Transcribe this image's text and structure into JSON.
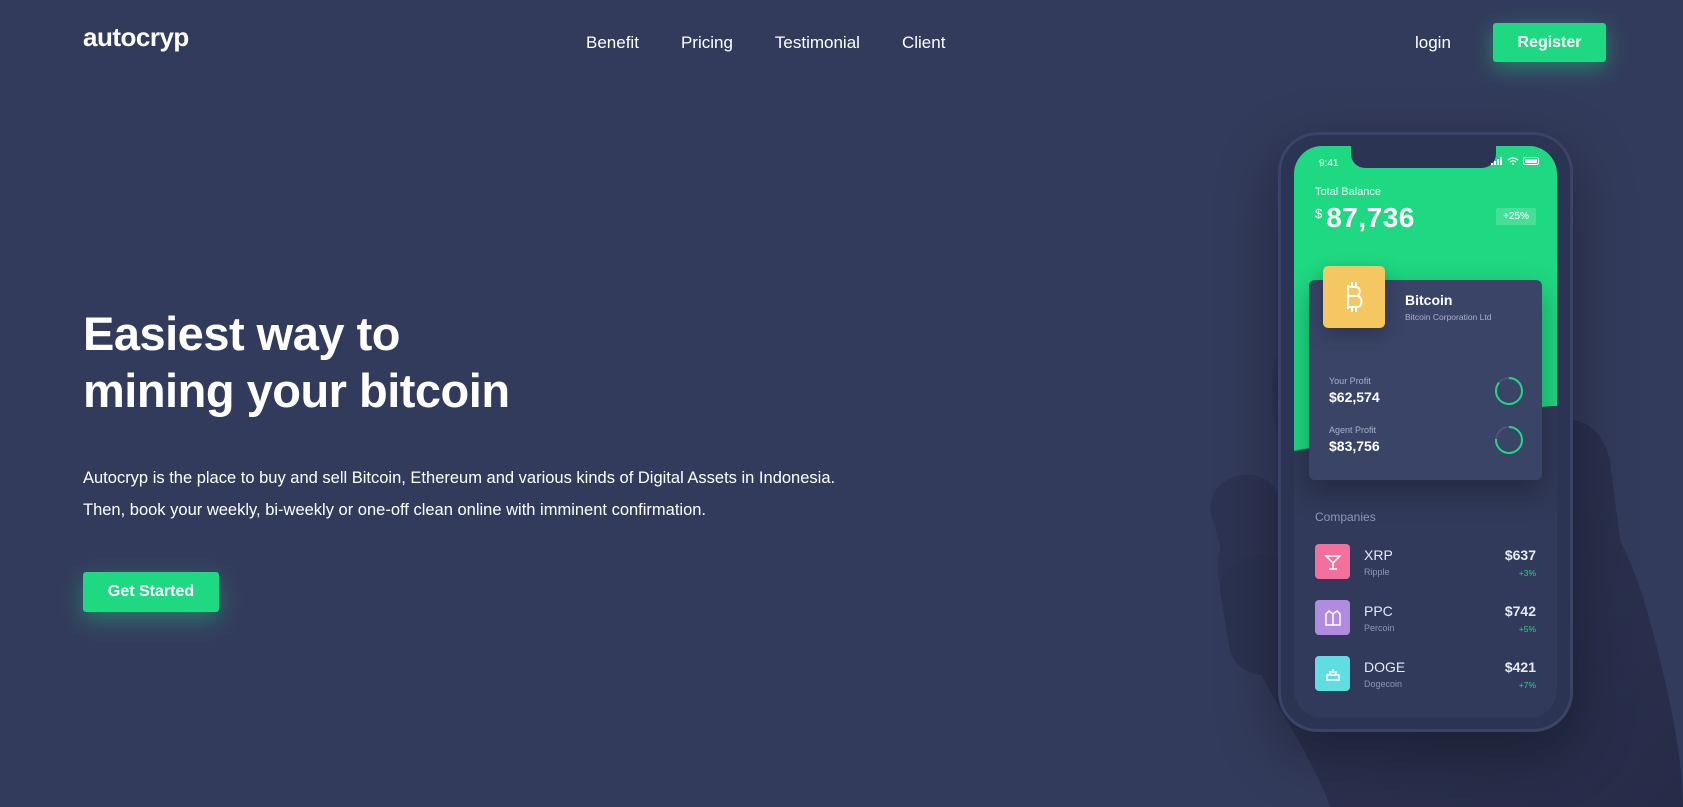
{
  "header": {
    "logo": "autocryp",
    "nav": [
      "Benefit",
      "Pricing",
      "Testimonial",
      "Client"
    ],
    "login_label": "login",
    "register_label": "Register"
  },
  "hero": {
    "title_lines": [
      "Easiest way to",
      "mining your bitcoin"
    ],
    "description_lines": [
      "Autocryp is the place to buy and sell Bitcoin, Ethereum and various kinds of Digital Assets in Indonesia.",
      "Then, book your weekly, bi-weekly or one-off clean online with imminent confirmation."
    ],
    "cta_label": "Get Started"
  },
  "phone": {
    "status_time": "9:41",
    "total_balance_label": "Total Balance",
    "currency_symbol": "$",
    "total_balance": "87,736",
    "balance_change": "+25%",
    "coin": {
      "name": "Bitcoin",
      "corporation": "Bitcoin Corporation Ltd",
      "icon": "bitcoin-icon"
    },
    "profits": [
      {
        "label": "Your Profit",
        "value": "$62,574"
      },
      {
        "label": "Agent Profit",
        "value": "$83,756"
      }
    ],
    "companies_title": "Companies",
    "companies": [
      {
        "symbol": "XRP",
        "name": "Ripple",
        "price": "$637",
        "change": "+3%",
        "color": "#f2709c",
        "icon": "cocktail-icon"
      },
      {
        "symbol": "PPC",
        "name": "Percoin",
        "price": "$742",
        "change": "+5%",
        "color": "#b18be0",
        "icon": "jacket-icon"
      },
      {
        "symbol": "DOGE",
        "name": "Dogecoin",
        "price": "$421",
        "change": "+7%",
        "color": "#5fdde0",
        "icon": "cake-icon"
      }
    ]
  },
  "colors": {
    "background": "#333b5c",
    "accent": "#1fd882",
    "bitcoin_tile": "#f5c763"
  }
}
